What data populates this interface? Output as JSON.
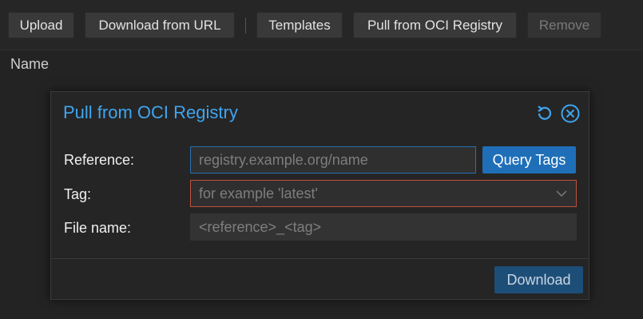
{
  "toolbar": {
    "upload": "Upload",
    "download_url": "Download from URL",
    "templates": "Templates",
    "pull_oci": "Pull from OCI Registry",
    "remove": "Remove"
  },
  "grid": {
    "column_name": "Name"
  },
  "dialog": {
    "title": "Pull from OCI Registry",
    "icons": {
      "reset": "reset-icon",
      "close": "close-icon"
    },
    "reference_label": "Reference:",
    "reference_placeholder": "registry.example.org/name",
    "reference_value": "",
    "query_tags_label": "Query Tags",
    "tag_label": "Tag:",
    "tag_placeholder": "for example 'latest'",
    "filename_label": "File name:",
    "filename_placeholder": "<reference>_<tag>",
    "download_label": "Download"
  },
  "colors": {
    "accent": "#3fa5f0",
    "primary_button": "#1f6fb8",
    "invalid_border": "#c0503c"
  }
}
